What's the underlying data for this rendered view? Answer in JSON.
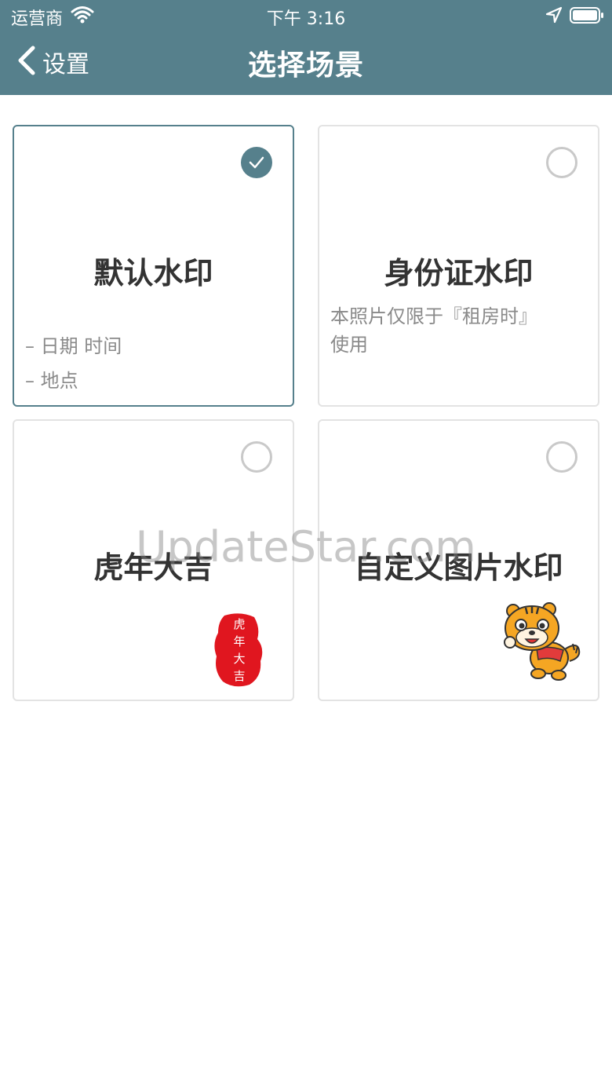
{
  "status_bar": {
    "carrier": "运营商",
    "time": "下午 3:16"
  },
  "nav": {
    "back_label": "设置",
    "title": "选择场景"
  },
  "cards": [
    {
      "title": "默认水印",
      "selected": true,
      "desc": [
        "– 日期 时间",
        "– 地点"
      ]
    },
    {
      "title": "身份证水印",
      "selected": false,
      "desc": [
        "本照片仅限于『租房时』",
        "使用"
      ]
    },
    {
      "title": "虎年大吉",
      "selected": false,
      "seal_text": [
        "虎",
        "年",
        "大",
        "吉"
      ]
    },
    {
      "title": "自定义图片水印",
      "selected": false
    }
  ],
  "watermark": "UpdateStar.com",
  "colors": {
    "accent": "#56808c",
    "seal": "#e0161f"
  }
}
